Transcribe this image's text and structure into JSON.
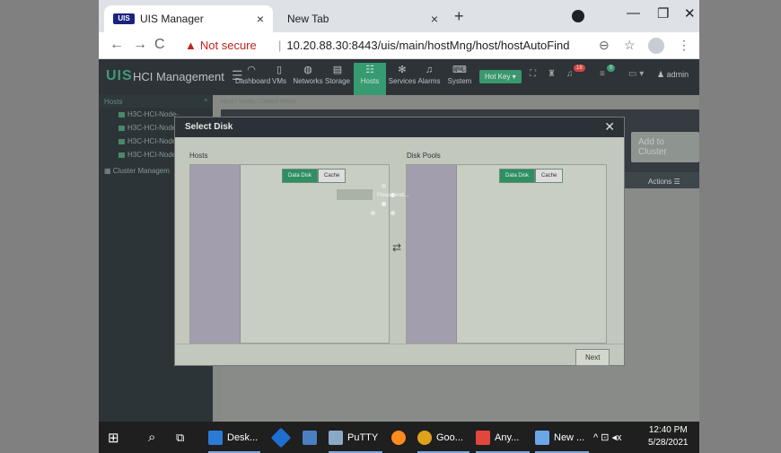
{
  "browser": {
    "tabs": [
      {
        "favicon": "UIS",
        "title": "UIS Manager",
        "close": "×"
      },
      {
        "title": "New Tab",
        "close": "×"
      }
    ],
    "new_tab": "+",
    "window_controls": {
      "minimize": "—",
      "maximize": "❐",
      "close": "✕"
    },
    "nav": {
      "back": "←",
      "forward": "→",
      "reload": "C"
    },
    "security_label": "Not secure",
    "url": "10.20.88.30:8443/uis/main/hostMng/host/hostAutoFind"
  },
  "app": {
    "logo": "UIS",
    "title": "HCI Management",
    "nav_items": [
      {
        "label": "Dashboard",
        "icon": "◠"
      },
      {
        "label": "VMs",
        "icon": "▯"
      },
      {
        "label": "Networks",
        "icon": "◍"
      },
      {
        "label": "Storage",
        "icon": "▤"
      },
      {
        "label": "Hosts",
        "icon": "☷",
        "active": true
      },
      {
        "label": "Services",
        "icon": "✻"
      },
      {
        "label": "Alarms",
        "icon": "♫"
      },
      {
        "label": "System",
        "icon": "⌨"
      }
    ],
    "hotkey": "Hot Key ▾",
    "alarm_badge": "18",
    "task_badge": "0",
    "user": "admin",
    "sidebar": {
      "section": "Hosts",
      "nodes": [
        "H3C-HCI-Node-",
        "H3C-HCI-Node-",
        "H3C-HCI-Node-",
        "H3C-HCI-Node-"
      ],
      "cluster": "Cluster Managem"
    },
    "breadcrumb": "Host / Hosts / Detect Hosts",
    "add_to_cluster": "Add to Cluster",
    "actions": "Actions"
  },
  "modal": {
    "title": "Select Disk",
    "close": "✕",
    "hosts_label": "Hosts",
    "pools_label": "Disk Pools",
    "seg_data": "Data Disk",
    "seg_cache": "Cache",
    "loading": "Please wait...",
    "transfer": "⇄",
    "next": "Next"
  },
  "taskbar": {
    "start": "⊞",
    "search": "⌕",
    "taskview": "⧉",
    "items": [
      "Desk...",
      "PuTTY",
      "Goo...",
      "Any...",
      "New ..."
    ],
    "tray": "^ ⊡ ◂x",
    "time": "12:40 PM",
    "date": "5/28/2021"
  }
}
